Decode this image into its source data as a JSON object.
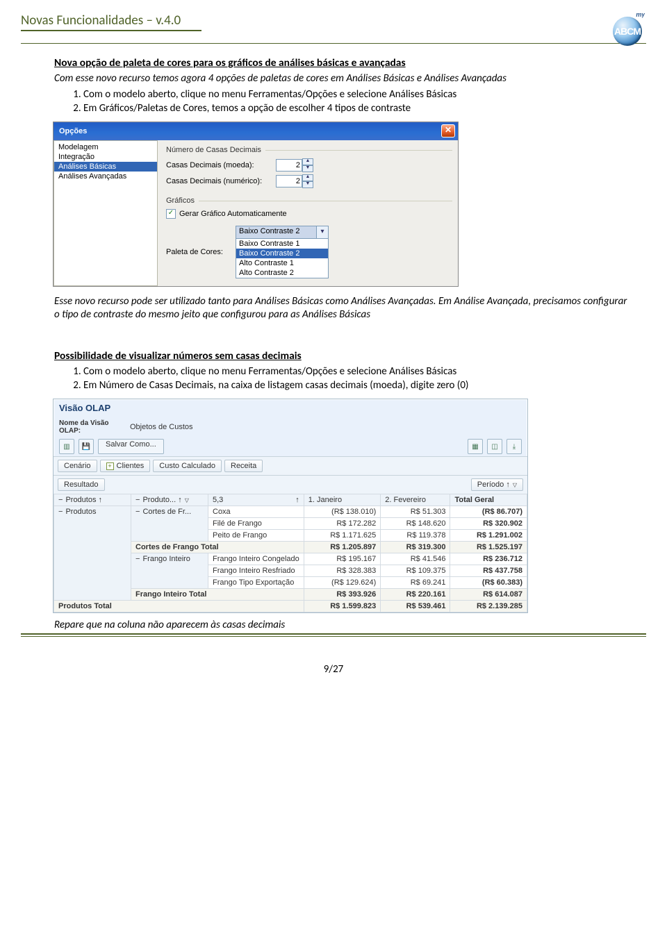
{
  "header": {
    "title": "Novas Funcionalidades – v.4.0",
    "logo_my": "my",
    "logo_text": "ABCM"
  },
  "section1": {
    "title": "Nova opção de paleta de cores para os gráficos de análises básicas e avançadas",
    "intro": "Com esse novo recurso temos agora 4 opções de paletas de cores em Análises Básicas e Análises Avançadas",
    "steps": [
      "Com o modelo aberto, clique no menu Ferramentas/Opções e selecione Análises Básicas",
      "Em Gráficos/Paletas de Cores, temos a opção de escolher 4 tipos de contraste"
    ],
    "after_text": "Esse novo recurso pode ser utilizado tanto para Análises Básicas como Análises Avançadas. Em Análise Avançada, precisamos configurar o tipo de contraste do mesmo jeito que configurou para as Análises Básicas"
  },
  "section2": {
    "title": "Possibilidade de visualizar números sem casas decimais",
    "steps": [
      "Com o modelo aberto, clique no menu Ferramentas/Opções e selecione Análises Básicas",
      "Em Número de Casas Decimais, na caixa de listagem casas decimais (moeda), digite zero (0)"
    ],
    "after_text": "Repare que na coluna não aparecem às casas decimais"
  },
  "xp": {
    "title": "Opções",
    "sidebar": [
      "Modelagem",
      "Integração",
      "Análises Básicas",
      "Análises Avançadas"
    ],
    "group_decimals": "Número de Casas Decimais",
    "row_moeda": "Casas Decimais (moeda):",
    "row_numerico": "Casas Decimais (numérico):",
    "val_moeda": "2",
    "val_numerico": "2",
    "group_graficos": "Gráficos",
    "checkbox": "Gerar Gráfico Automaticamente",
    "paleta_label": "Paleta de Cores:",
    "paleta_selected": "Baixo Contraste 2",
    "paleta_options": [
      "Baixo Contraste 1",
      "Baixo Contraste 2",
      "Alto Contraste 1",
      "Alto Contraste 2"
    ]
  },
  "olap": {
    "title": "Visão OLAP",
    "name_label": "Nome da Visão OLAP:",
    "name_value": "Objetos de Custos",
    "save_as": "Salvar Como...",
    "chips_top": [
      {
        "label": "Cenário",
        "pm": ""
      },
      {
        "label": "Clientes",
        "pm": "+"
      },
      {
        "label": "Custo Calculado",
        "pm": ""
      },
      {
        "label": "Receita",
        "pm": ""
      }
    ],
    "chip_resultado": "Resultado",
    "chip_periodo": "Período  ↑",
    "row_head_chips": [
      {
        "label": "Produtos  ↑",
        "pm": "−"
      },
      {
        "label": "Produto...  ↑",
        "pm": "−"
      },
      {
        "label": "5,3",
        "pm": ""
      }
    ],
    "col_names": [
      "1. Janeiro",
      "2. Fevereiro",
      "Total Geral"
    ],
    "left_chips_row2": [
      {
        "label": "Produtos",
        "pm": "−"
      },
      {
        "label": "Cortes de Fr...",
        "pm": "−"
      }
    ],
    "rows_cortes": [
      {
        "name": "Coxa",
        "jan": "(R$ 138.010)",
        "fev": "R$ 51.303",
        "tot": "(R$ 86.707)"
      },
      {
        "name": "Filé de Frango",
        "jan": "R$ 172.282",
        "fev": "R$ 148.620",
        "tot": "R$ 320.902"
      },
      {
        "name": "Peito de Frango",
        "jan": "R$ 1.171.625",
        "fev": "R$ 119.378",
        "tot": "R$ 1.291.002"
      }
    ],
    "cortes_total": {
      "name": "Cortes de Frango Total",
      "jan": "R$ 1.205.897",
      "fev": "R$ 319.300",
      "tot": "R$ 1.525.197"
    },
    "chip_frango": {
      "label": "Frango Inteiro",
      "pm": "−"
    },
    "rows_frango": [
      {
        "name": "Frango Inteiro Congelado",
        "jan": "R$ 195.167",
        "fev": "R$ 41.546",
        "tot": "R$ 236.712"
      },
      {
        "name": "Frango Inteiro Resfriado",
        "jan": "R$ 328.383",
        "fev": "R$ 109.375",
        "tot": "R$ 437.758"
      },
      {
        "name": "Frango Tipo Exportação",
        "jan": "(R$ 129.624)",
        "fev": "R$ 69.241",
        "tot": "(R$ 60.383)"
      }
    ],
    "frango_total": {
      "name": "Frango Inteiro Total",
      "jan": "R$ 393.926",
      "fev": "R$ 220.161",
      "tot": "R$ 614.087"
    },
    "produtos_total": {
      "name": "Produtos Total",
      "jan": "R$ 1.599.823",
      "fev": "R$ 539.461",
      "tot": "R$ 2.139.285"
    }
  },
  "footer": "9/27"
}
